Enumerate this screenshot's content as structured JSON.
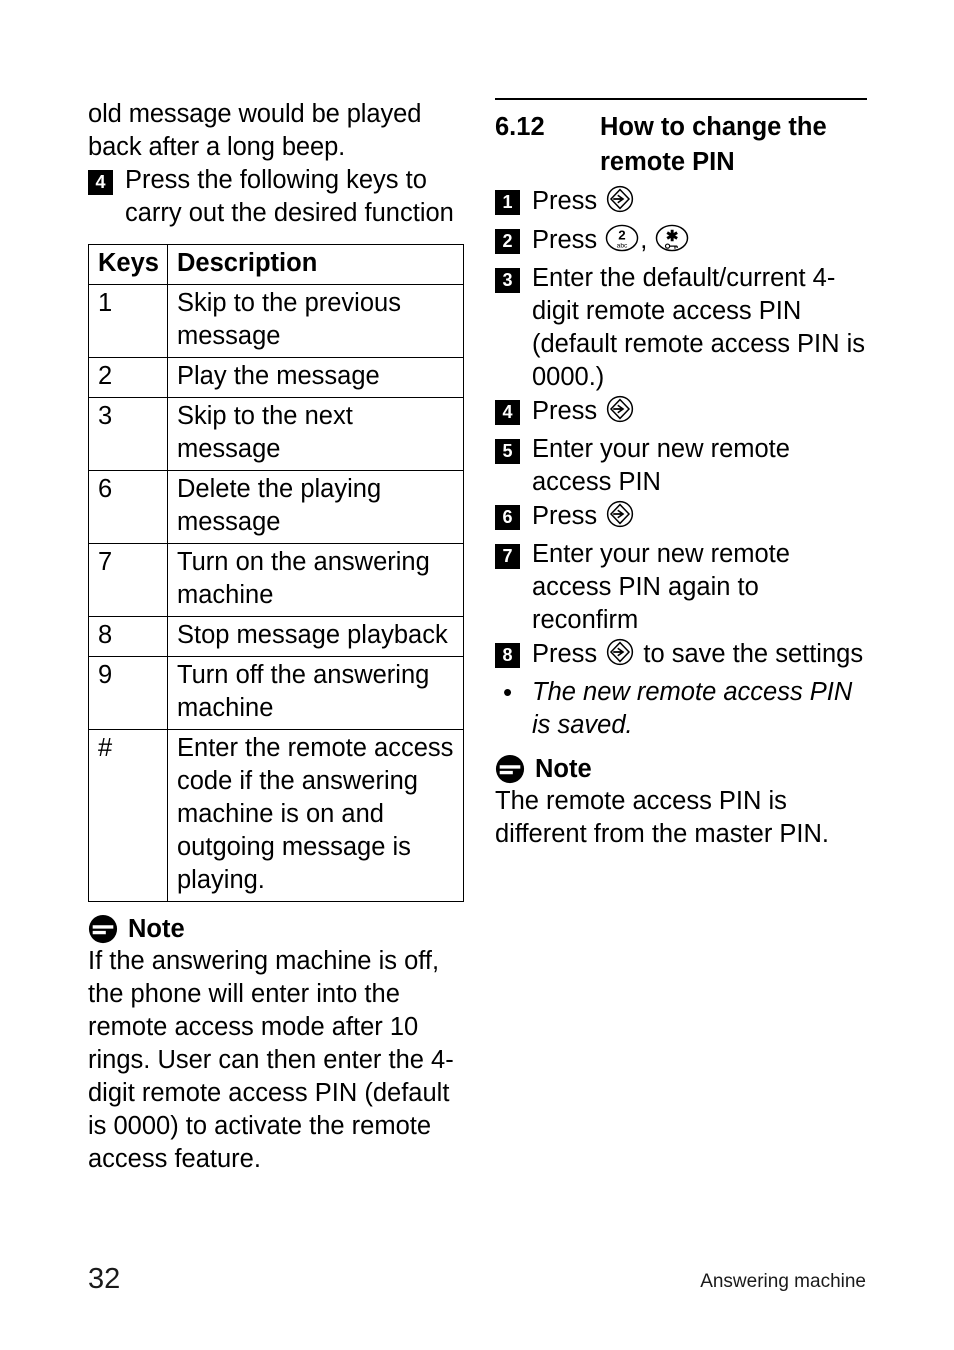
{
  "document": {
    "page_number": "32",
    "footer_label": "Answering machine"
  },
  "left_column": {
    "continued_paragraph": "old message would be played back after a long beep.",
    "step": {
      "number": "4",
      "text": "Press the following keys to carry out the desired function"
    },
    "table": {
      "headers": [
        "Keys",
        "Description"
      ],
      "rows": [
        {
          "key": "1",
          "description": "Skip to the previous message"
        },
        {
          "key": "2",
          "description": "Play the message"
        },
        {
          "key": "3",
          "description": "Skip to the next message"
        },
        {
          "key": "6",
          "description": "Delete the playing message"
        },
        {
          "key": "7",
          "description": "Turn on the answering machine"
        },
        {
          "key": "8",
          "description": "Stop message playback"
        },
        {
          "key": "9",
          "description": "Turn off the answering machine"
        },
        {
          "key": "#",
          "description": "Enter the remote access code if the answering machine is on and outgoing message is playing."
        }
      ]
    },
    "note": {
      "icon": "note-icon",
      "title": "Note",
      "body": "If the answering machine is off, the phone will enter into the remote access mode after 10 rings. User can then enter the 4-digit remote access PIN (default is 0000) to activate the remote access feature."
    }
  },
  "right_column": {
    "section": {
      "number": "6.12",
      "title": "How to change the remote PIN"
    },
    "steps": [
      {
        "number": "1",
        "text_before": "Press ",
        "icons": [
          "menu-select-key-icon"
        ],
        "text_after": ""
      },
      {
        "number": "2",
        "text_before": "Press ",
        "icons": [
          "digit-2-abc-key-icon",
          "star-key-icon"
        ],
        "separator": ",",
        "text_after": ""
      },
      {
        "number": "3",
        "text_before": "Enter the default/current 4-digit remote access PIN (default remote access PIN is 0000.)",
        "icons": [],
        "text_after": ""
      },
      {
        "number": "4",
        "text_before": "Press ",
        "icons": [
          "menu-select-key-icon"
        ],
        "text_after": ""
      },
      {
        "number": "5",
        "text_before": "Enter your new remote access PIN",
        "icons": [],
        "text_after": ""
      },
      {
        "number": "6",
        "text_before": "Press ",
        "icons": [
          "menu-select-key-icon"
        ],
        "text_after": ""
      },
      {
        "number": "7",
        "text_before": "Enter your new remote access PIN again to reconfirm",
        "icons": [],
        "text_after": ""
      },
      {
        "number": "8",
        "text_before": "Press ",
        "icons": [
          "menu-select-key-icon"
        ],
        "text_after": " to save the settings"
      }
    ],
    "bullet": {
      "marker": "•",
      "text": "The new remote access PIN is saved."
    },
    "note": {
      "icon": "note-icon",
      "title": "Note",
      "body": "The remote access PIN is different from the master PIN."
    }
  },
  "key_glyph_labels": {
    "digit_2": "2",
    "digit_2_sub": "abc",
    "star": "✱"
  },
  "colors": {
    "ink": "#000000",
    "paper": "#ffffff",
    "footer_ink": "#1a1a1a"
  }
}
